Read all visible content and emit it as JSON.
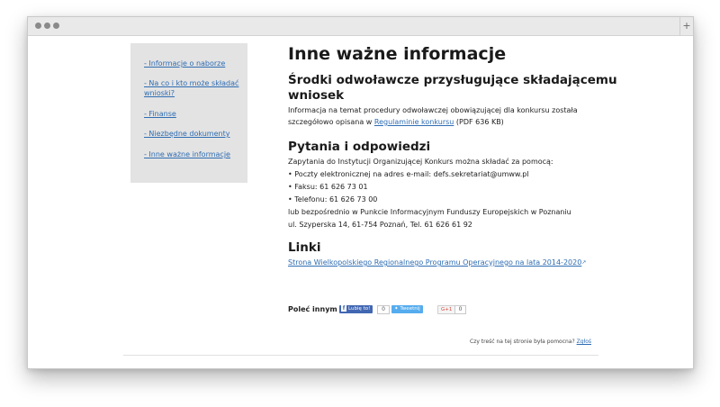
{
  "sidebar": {
    "items": [
      {
        "label": "- Informacje o naborze"
      },
      {
        "label": "- Na co i kto może składać wnioski?"
      },
      {
        "label": "- Finanse"
      },
      {
        "label": "- Niezbędne dokumenty"
      },
      {
        "label": "- Inne ważne informacje"
      }
    ]
  },
  "main": {
    "title": "Inne ważne informacje",
    "remedies": {
      "heading_line1": "Środki odwoławcze przysługujące składającemu",
      "heading_line2": "wniosek",
      "text_line1": "Informacja na temat procedury odwoławczej obowiązującej dla konkursu została",
      "text_pre": "szczegółowo opisana w ",
      "link": "Regulaminie konkursu",
      "text_post": " (PDF 636 KB)"
    },
    "qa": {
      "heading": "Pytania i odpowiedzi",
      "line1": "Zapytania do Instytucji Organizującej Konkurs można składać za pomocą:",
      "line2": "• Poczty elektronicznej na adres e-mail: defs.sekretariat@umww.pl",
      "line3": "• Faksu: 61 626 73 01",
      "line4": "• Telefonu: 61 626 73 00",
      "line5": "lub bezpośrednio w Punkcie Informacyjnym Funduszy Europejskich w Poznaniu",
      "line6": "ul. Szyperska 14, 61-754 Poznań, Tel. 61 626 61 92"
    },
    "links": {
      "heading": "Linki",
      "link1": "Strona Wielkopolskiego Regionalnego Programu Operacyjnego na lata 2014-2020"
    }
  },
  "share": {
    "label": "Poleć innym",
    "fb_label": "Lubię to!",
    "fb_count": "0",
    "tw_label": "Tweetnij",
    "gp_label": "G+1",
    "gp_count": "0"
  },
  "footer": {
    "question": "Czy treść na tej stronie była pomocna?",
    "report_link": "Zgłoś"
  }
}
